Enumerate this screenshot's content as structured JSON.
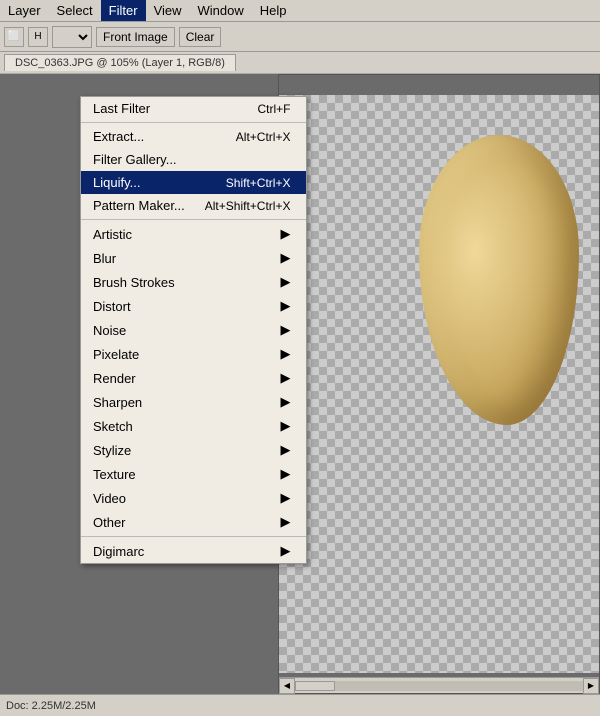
{
  "menubar": {
    "items": [
      {
        "label": "Layer",
        "active": false
      },
      {
        "label": "Select",
        "active": false
      },
      {
        "label": "Filter",
        "active": true
      },
      {
        "label": "View",
        "active": false
      },
      {
        "label": "Window",
        "active": false
      },
      {
        "label": "Help",
        "active": false
      }
    ]
  },
  "toolbar": {
    "dropdown_value": "",
    "front_image_label": "Front Image",
    "clear_label": "Clear"
  },
  "canvas_title": "DSC_0363.JPG @ 105% (Layer 1, RGB/8)",
  "filter_menu": {
    "items": [
      {
        "label": "Last Filter",
        "shortcut": "Ctrl+F",
        "type": "item",
        "disabled": false
      },
      {
        "type": "separator"
      },
      {
        "label": "Extract...",
        "shortcut": "Alt+Ctrl+X",
        "type": "item"
      },
      {
        "label": "Filter Gallery...",
        "shortcut": "",
        "type": "item"
      },
      {
        "label": "Liquify...",
        "shortcut": "Shift+Ctrl+X",
        "type": "item",
        "highlighted": true
      },
      {
        "label": "Pattern Maker...",
        "shortcut": "Alt+Shift+Ctrl+X",
        "type": "item"
      },
      {
        "type": "separator"
      },
      {
        "label": "Artistic",
        "shortcut": "",
        "type": "submenu"
      },
      {
        "label": "Blur",
        "shortcut": "",
        "type": "submenu"
      },
      {
        "label": "Brush Strokes",
        "shortcut": "",
        "type": "submenu"
      },
      {
        "label": "Distort",
        "shortcut": "",
        "type": "submenu"
      },
      {
        "label": "Noise",
        "shortcut": "",
        "type": "submenu"
      },
      {
        "label": "Pixelate",
        "shortcut": "",
        "type": "submenu"
      },
      {
        "label": "Render",
        "shortcut": "",
        "type": "submenu"
      },
      {
        "label": "Sharpen",
        "shortcut": "",
        "type": "submenu"
      },
      {
        "label": "Sketch",
        "shortcut": "",
        "type": "submenu"
      },
      {
        "label": "Stylize",
        "shortcut": "",
        "type": "submenu"
      },
      {
        "label": "Texture",
        "shortcut": "",
        "type": "submenu"
      },
      {
        "label": "Video",
        "shortcut": "",
        "type": "submenu"
      },
      {
        "label": "Other",
        "shortcut": "",
        "type": "submenu"
      },
      {
        "type": "separator"
      },
      {
        "label": "Digimarc",
        "shortcut": "",
        "type": "submenu"
      }
    ]
  },
  "status_bar": {
    "text": "Doc: 2.25M/2.25M"
  }
}
